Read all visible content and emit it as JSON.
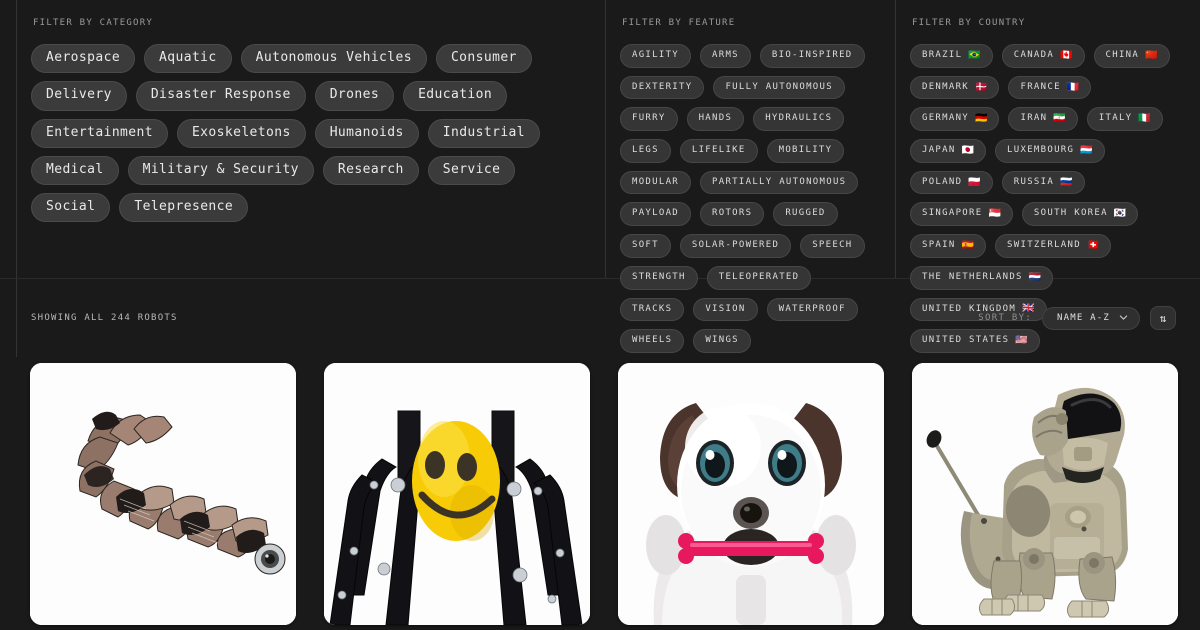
{
  "filters": {
    "category": {
      "title": "FILTER BY CATEGORY",
      "chips": [
        "Aerospace",
        "Aquatic",
        "Autonomous Vehicles",
        "Consumer",
        "Delivery",
        "Disaster Response",
        "Drones",
        "Education",
        "Entertainment",
        "Exoskeletons",
        "Humanoids",
        "Industrial",
        "Medical",
        "Military & Security",
        "Research",
        "Service",
        "Social",
        "Telepresence"
      ]
    },
    "feature": {
      "title": "FILTER BY FEATURE",
      "chips": [
        "AGILITY",
        "ARMS",
        "BIO-INSPIRED",
        "DEXTERITY",
        "FULLY AUTONOMOUS",
        "FURRY",
        "HANDS",
        "HYDRAULICS",
        "LEGS",
        "LIFELIKE",
        "MOBILITY",
        "MODULAR",
        "PARTIALLY AUTONOMOUS",
        "PAYLOAD",
        "ROTORS",
        "RUGGED",
        "SOFT",
        "SOLAR-POWERED",
        "SPEECH",
        "STRENGTH",
        "TELEOPERATED",
        "TRACKS",
        "VISION",
        "WATERPROOF",
        "WHEELS",
        "WINGS"
      ]
    },
    "country": {
      "title": "FILTER BY COUNTRY",
      "chips": [
        {
          "label": "BRAZIL",
          "flag": "🇧🇷"
        },
        {
          "label": "CANADA",
          "flag": "🇨🇦"
        },
        {
          "label": "CHINA",
          "flag": "🇨🇳"
        },
        {
          "label": "DENMARK",
          "flag": "🇩🇰"
        },
        {
          "label": "FRANCE",
          "flag": "🇫🇷"
        },
        {
          "label": "GERMANY",
          "flag": "🇩🇪"
        },
        {
          "label": "IRAN",
          "flag": "🇮🇷"
        },
        {
          "label": "ITALY",
          "flag": "🇮🇹"
        },
        {
          "label": "JAPAN",
          "flag": "🇯🇵"
        },
        {
          "label": "LUXEMBOURG",
          "flag": "🇱🇺"
        },
        {
          "label": "POLAND",
          "flag": "🇵🇱"
        },
        {
          "label": "RUSSIA",
          "flag": "🇷🇺"
        },
        {
          "label": "SINGAPORE",
          "flag": "🇸🇬"
        },
        {
          "label": "SOUTH KOREA",
          "flag": "🇰🇷"
        },
        {
          "label": "SPAIN",
          "flag": "🇪🇸"
        },
        {
          "label": "SWITZERLAND",
          "flag": "🇨🇭"
        },
        {
          "label": "THE NETHERLANDS",
          "flag": "🇳🇱"
        },
        {
          "label": "UNITED KINGDOM",
          "flag": "🇬🇧"
        },
        {
          "label": "UNITED STATES",
          "flag": "🇺🇸"
        }
      ]
    }
  },
  "results": {
    "count_text": "SHOWING ALL 244 ROBOTS",
    "sort_label": "SORT BY:",
    "sort_value": "NAME A-Z",
    "sort_direction_icon": "⇅"
  },
  "cards": [
    {
      "name": "modular-snake-robot",
      "alt": "Modular snake robot with segmented metallic links"
    },
    {
      "name": "yellow-smiley-legged-robot",
      "alt": "Black legged robot with yellow smiley face head"
    },
    {
      "name": "white-robot-dog-closeup",
      "alt": "White and brown robot dog holding a pink bone"
    },
    {
      "name": "silver-robot-dog",
      "alt": "Silver metallic robot dog standing"
    }
  ],
  "colors": {
    "background": "#1a1a1a",
    "chip_bg": "#3b3b3b",
    "chip_border": "#4a4a4a",
    "divider": "#333333",
    "text_muted": "#9a9a9a",
    "card_bg": "#ffffff"
  }
}
